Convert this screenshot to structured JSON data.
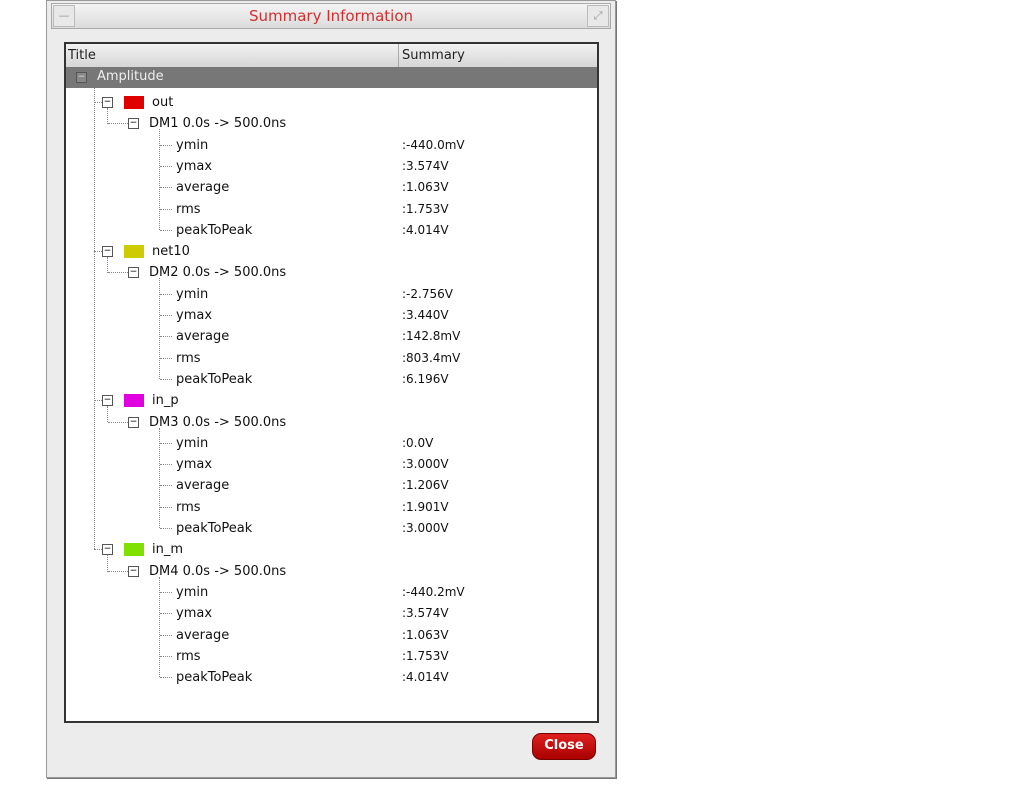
{
  "window": {
    "title": "Summary Information"
  },
  "table": {
    "columns": [
      "Title",
      "Summary"
    ],
    "group": "Amplitude"
  },
  "signals": [
    {
      "name": "out",
      "color": "#e00000",
      "dm": "DM1 0.0s -> 500.0ns",
      "stats": [
        [
          "ymin",
          ":-440.0mV"
        ],
        [
          "ymax",
          ":3.574V"
        ],
        [
          "average",
          ":1.063V"
        ],
        [
          "rms",
          ":1.753V"
        ],
        [
          "peakToPeak",
          ":4.014V"
        ]
      ]
    },
    {
      "name": "net10",
      "color": "#cccc00",
      "dm": "DM2 0.0s -> 500.0ns",
      "stats": [
        [
          "ymin",
          ":-2.756V"
        ],
        [
          "ymax",
          ":3.440V"
        ],
        [
          "average",
          ":142.8mV"
        ],
        [
          "rms",
          ":803.4mV"
        ],
        [
          "peakToPeak",
          ":6.196V"
        ]
      ]
    },
    {
      "name": "in_p",
      "color": "#e000e0",
      "dm": "DM3 0.0s -> 500.0ns",
      "stats": [
        [
          "ymin",
          ":0.0V"
        ],
        [
          "ymax",
          ":3.000V"
        ],
        [
          "average",
          ":1.206V"
        ],
        [
          "rms",
          ":1.901V"
        ],
        [
          "peakToPeak",
          ":3.000V"
        ]
      ]
    },
    {
      "name": "in_m",
      "color": "#80e000",
      "dm": "DM4 0.0s -> 500.0ns",
      "stats": [
        [
          "ymin",
          ":-440.2mV"
        ],
        [
          "ymax",
          ":3.574V"
        ],
        [
          "average",
          ":1.063V"
        ],
        [
          "rms",
          ":1.753V"
        ],
        [
          "peakToPeak",
          ":4.014V"
        ]
      ]
    }
  ],
  "buttons": {
    "close": "Close"
  }
}
